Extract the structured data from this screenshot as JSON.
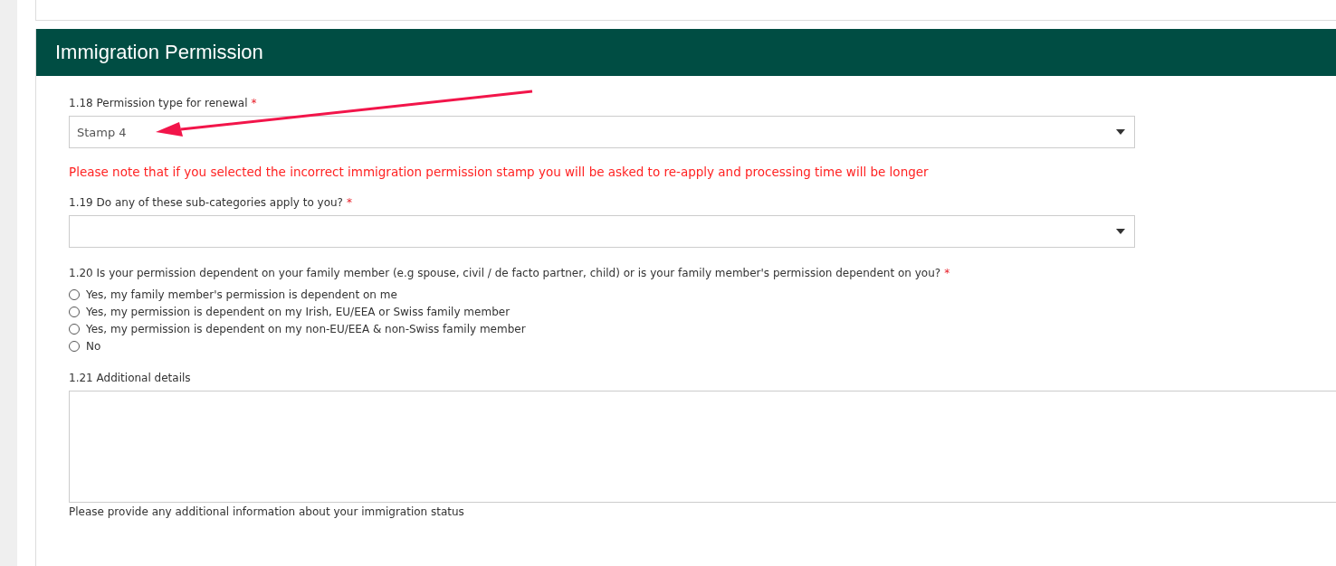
{
  "section": {
    "title": "Immigration Permission"
  },
  "fields": [
    {
      "kind": "select",
      "label": "1.18 Permission type for renewal",
      "required_mark": "*",
      "value": "Stamp 4"
    },
    {
      "kind": "note",
      "text": "Please note that if you selected the incorrect immigration permission stamp you will be asked to re-apply and processing time will be longer"
    },
    {
      "kind": "select",
      "label": "1.19 Do any of these sub-categories apply to you?",
      "required_mark": "*"
    },
    {
      "kind": "radio",
      "label": "1.20 Is your permission dependent on your family member (e.g spouse, civil / de facto partner, child) or is your family member's permission dependent on you?",
      "required_mark": "*",
      "options": [
        {
          "label": "Yes, my family member's permission is dependent on me",
          "selected": false
        },
        {
          "label": "Yes, my permission is dependent on my Irish, EU/EEA or Swiss family member",
          "selected": false
        },
        {
          "label": "Yes, my permission is dependent on my non-EU/EEA & non-Swiss family member",
          "selected": false
        },
        {
          "label": "No",
          "selected": false
        }
      ]
    },
    {
      "kind": "textarea",
      "label": "1.21 Additional details",
      "help": "Please provide any additional information about your immigration status"
    }
  ]
}
